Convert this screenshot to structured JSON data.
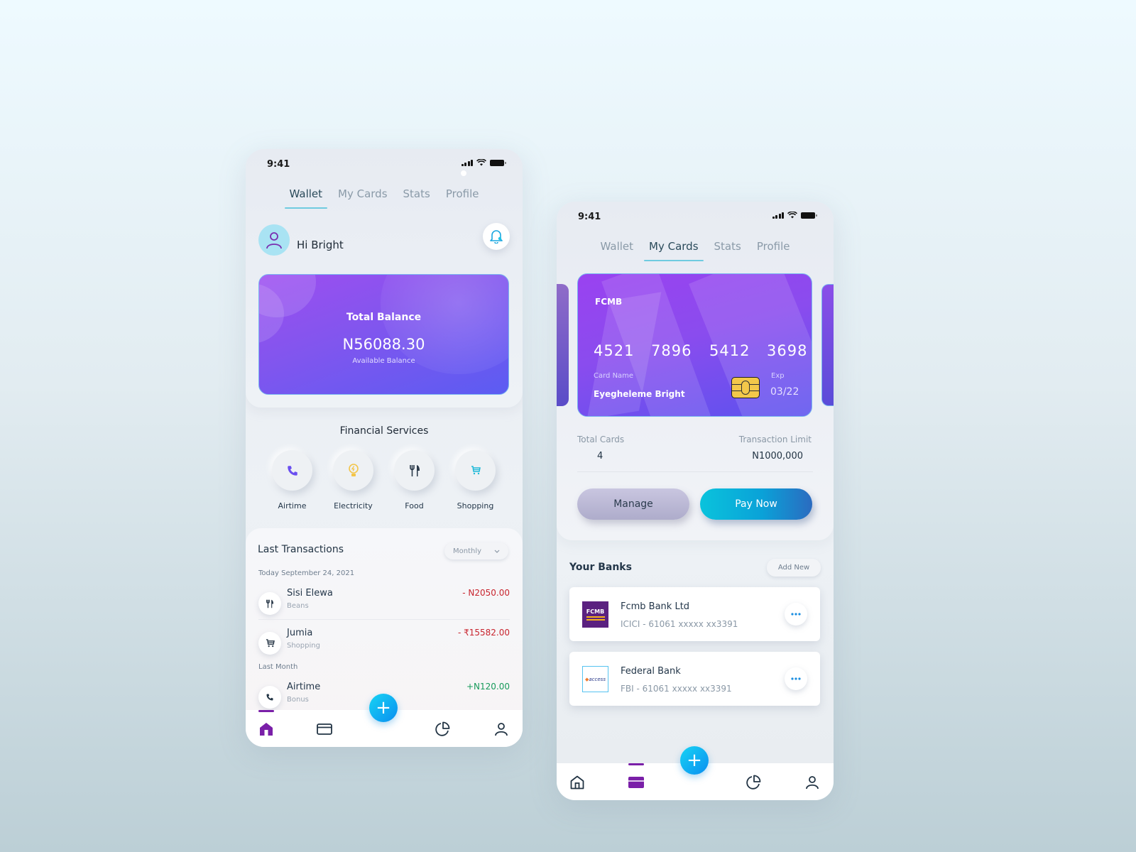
{
  "status_bar": {
    "time": "9:41"
  },
  "tabs": [
    "Wallet",
    "My Cards",
    "Stats",
    "Profile"
  ],
  "wallet_screen": {
    "active_tab": "Wallet",
    "greeting": "Hi  Bright",
    "balance_card": {
      "title": "Total Balance",
      "amount": "N56088.30",
      "subtitle": "Available Balance"
    },
    "financial_services": {
      "title": "Financial Services",
      "items": [
        {
          "label": "Airtime",
          "icon": "phone-icon",
          "color": "#6a4ff0"
        },
        {
          "label": "Electricity",
          "icon": "lightbulb-icon",
          "color": "#f3c54a"
        },
        {
          "label": "Food",
          "icon": "fork-knife-icon",
          "color": "#2b3a4a"
        },
        {
          "label": "Shopping",
          "icon": "cart-icon",
          "color": "#1fb9d8"
        }
      ]
    },
    "transactions": {
      "title": "Last Transactions",
      "filter": "Monthly",
      "groups": [
        {
          "label": "Today September 24, 2021",
          "items": [
            {
              "name": "Sisi Elewa",
              "category": "Beans",
              "amount": "- N2050.00",
              "type": "debit",
              "icon": "fork-knife-icon"
            },
            {
              "name": "Jumia",
              "category": "Shopping",
              "amount": "- ₹15582.00",
              "type": "debit",
              "icon": "cart-icon"
            }
          ]
        },
        {
          "label": "Last Month",
          "items": [
            {
              "name": "Airtime",
              "category": "Bonus",
              "amount": "+N120.00",
              "type": "credit",
              "icon": "phone-icon"
            }
          ]
        }
      ]
    },
    "bottom_nav": {
      "active": "home"
    }
  },
  "cards_screen": {
    "active_tab": "My Cards",
    "card": {
      "bank": "FCMB",
      "number_groups": [
        "4521",
        "7896",
        "5412",
        "3698"
      ],
      "name_label": "Card Name",
      "name": "Eyegheleme Bright",
      "exp_label": "Exp",
      "exp": "03/22"
    },
    "stats": {
      "total_cards_label": "Total Cards",
      "total_cards": "4",
      "limit_label": "Transaction Limit",
      "limit": "N1000,000"
    },
    "buttons": {
      "manage": "Manage",
      "pay_now": "Pay Now"
    },
    "banks": {
      "title": "Your Banks",
      "add_new": "Add New",
      "items": [
        {
          "name": "Fcmb Bank Ltd",
          "account": "ICICI - 61061  xxxxx  xx3391",
          "logo_text": "FCMB"
        },
        {
          "name": "Federal Bank",
          "account": "FBI - 61061  xxxxx  xx3391",
          "logo_text": "access"
        }
      ]
    },
    "bottom_nav": {
      "active": "cards"
    }
  },
  "colors": {
    "accent_purple": "#7a1fa8",
    "fab_blue": "#0aa8f0",
    "debit_red": "#c8242e",
    "credit_green": "#179a5a",
    "tab_underline": "#6fcbe0"
  }
}
